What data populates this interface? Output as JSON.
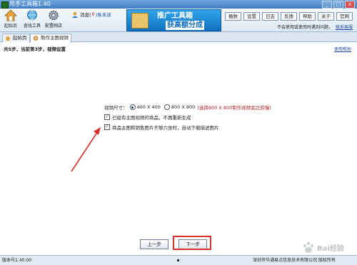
{
  "window": {
    "title": "甩手工具箱1.40",
    "controls": [
      "_",
      "□",
      "x"
    ]
  },
  "toolbar": {
    "tools": [
      {
        "label": "起始页",
        "icon": "home-icon"
      },
      {
        "label": "查找工具",
        "icon": "globe-search-icon"
      },
      {
        "label": "配置网店",
        "icon": "gear-icon"
      }
    ],
    "message": {
      "label": "消息(",
      "count": "0",
      "unread": ")条未读"
    },
    "banner": {
      "line1": "推广工具箱",
      "line2": "获高额分成"
    },
    "menu": [
      "换肤",
      "设置",
      "日志",
      "反馈",
      "帮助",
      "关于",
      "官网"
    ],
    "help_text": "不会使用或使用时遇到问题，",
    "help_link": "联系客服"
  },
  "tabs": [
    {
      "label": "起始页",
      "icon": "home-icon",
      "active": false
    },
    {
      "label": "制作主图视频",
      "icon": "video-icon",
      "active": true
    }
  ],
  "step": {
    "text": "共5步，当前第3步，视频设置",
    "help_link": "使用帮助"
  },
  "form": {
    "size_label": "视频尺寸：",
    "options": [
      {
        "label": "400 X 400",
        "selected": true
      },
      {
        "label": "800 X 800",
        "selected": false
      }
    ],
    "size_hint": "(选择800 X 800制作视频会比较慢)",
    "checks": [
      {
        "label": "已经有主图视频的商品，不再重新生成",
        "checked": true
      },
      {
        "label": "商品主图和销售图片不够六张时，自动下载描述图片",
        "checked": true
      }
    ]
  },
  "nav": {
    "prev": "上一步",
    "next": "下一步"
  },
  "statusbar": {
    "version": "版本号1.40.00",
    "company": "深圳市华通易点信息技术有限公司 版权所有"
  },
  "watermark": "Bai经验",
  "colors": {
    "accent": "#3f7cc4",
    "annotation": "#d9302c",
    "hint": "#b02020"
  }
}
